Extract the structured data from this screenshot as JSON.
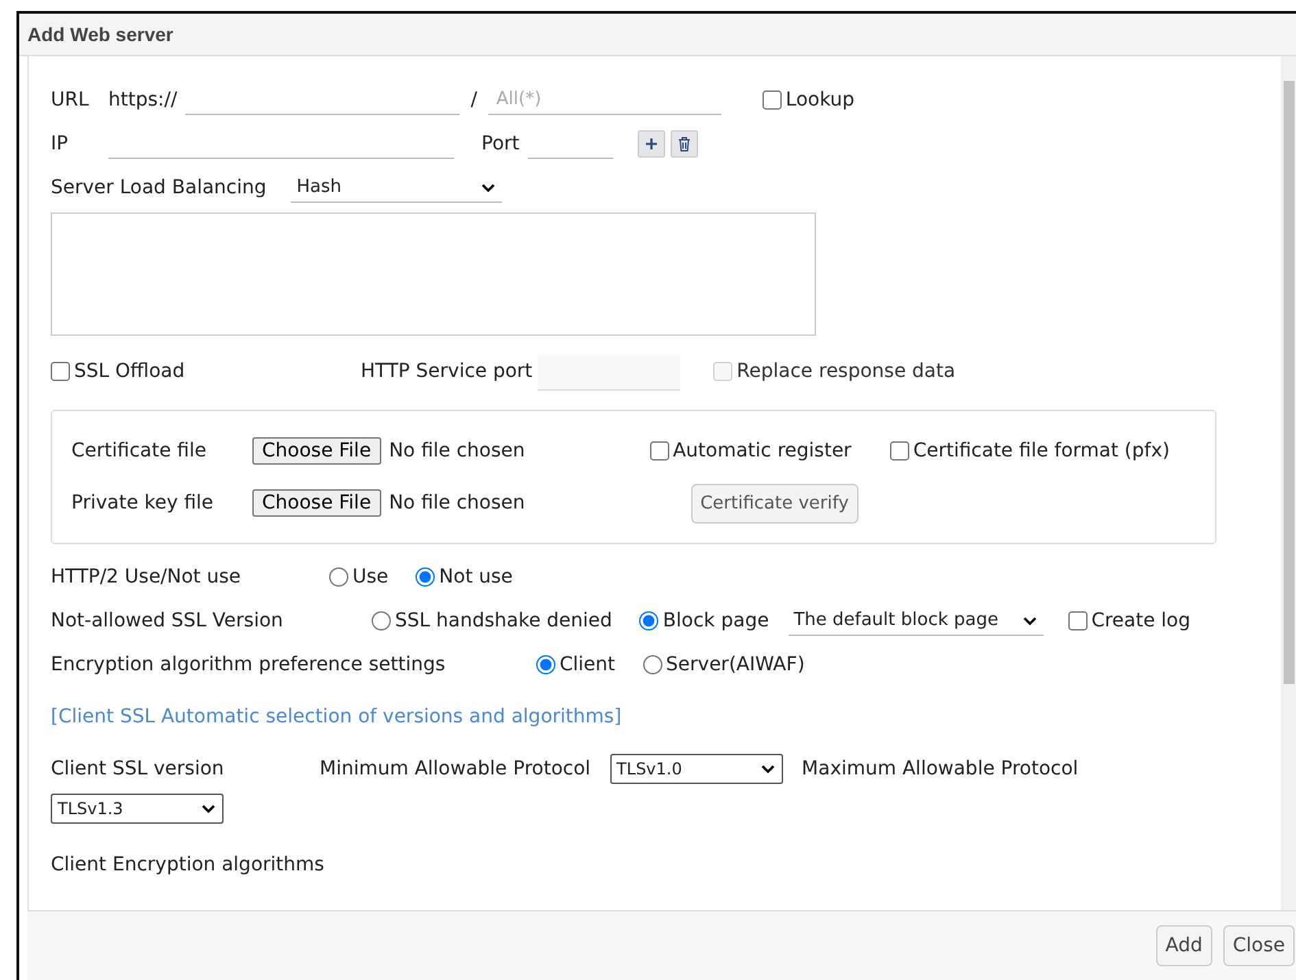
{
  "window": {
    "title": "Add Web server"
  },
  "url": {
    "label": "URL",
    "scheme": "https://",
    "separator": "/",
    "path_placeholder": "All(*)",
    "lookup": {
      "label": "Lookup",
      "checked": false
    }
  },
  "ip": {
    "label": "IP",
    "port_label": "Port"
  },
  "balancing": {
    "label": "Server Load Balancing",
    "value": "Hash"
  },
  "ssl_offload": {
    "label": "SSL Offload",
    "checked": false
  },
  "http_port": {
    "label": "HTTP Service port"
  },
  "replace": {
    "label": "Replace response data",
    "checked": false,
    "disabled": true
  },
  "certificate": {
    "rows": [
      {
        "label": "Certificate file",
        "button": "Choose File",
        "status": "No file chosen"
      },
      {
        "label": "Private key file",
        "button": "Choose File",
        "status": "No file chosen"
      }
    ],
    "auto_register": {
      "label": "Automatic register",
      "checked": false
    },
    "pfx": {
      "label": "Certificate file format (pfx)",
      "checked": false
    },
    "verify": "Certificate verify"
  },
  "http2": {
    "label": "HTTP/2 Use/Not use",
    "options": [
      {
        "label": "Use",
        "selected": false
      },
      {
        "label": "Not use",
        "selected": true
      }
    ]
  },
  "not_allowed": {
    "label": "Not-allowed SSL Version",
    "options": [
      {
        "label": "SSL handshake denied",
        "selected": false
      },
      {
        "label": "Block page",
        "selected": true
      }
    ],
    "page": "The default block page",
    "create_log": {
      "label": "Create log",
      "checked": false
    }
  },
  "preference": {
    "label": "Encryption algorithm preference settings",
    "options": [
      {
        "label": "Client",
        "selected": true
      },
      {
        "label": "Server(AIWAF)",
        "selected": false
      }
    ]
  },
  "auto_link": "[Client SSL Automatic selection of versions and algorithms]",
  "client_version": {
    "label": "Client SSL version",
    "min_label": "Minimum Allowable Protocol",
    "min": "TLSv1.0",
    "max_label": "Maximum Allowable Protocol",
    "max": "TLSv1.3"
  },
  "algorithms_label": "Client Encryption algorithms",
  "buttons": [
    "Add",
    "Close"
  ]
}
